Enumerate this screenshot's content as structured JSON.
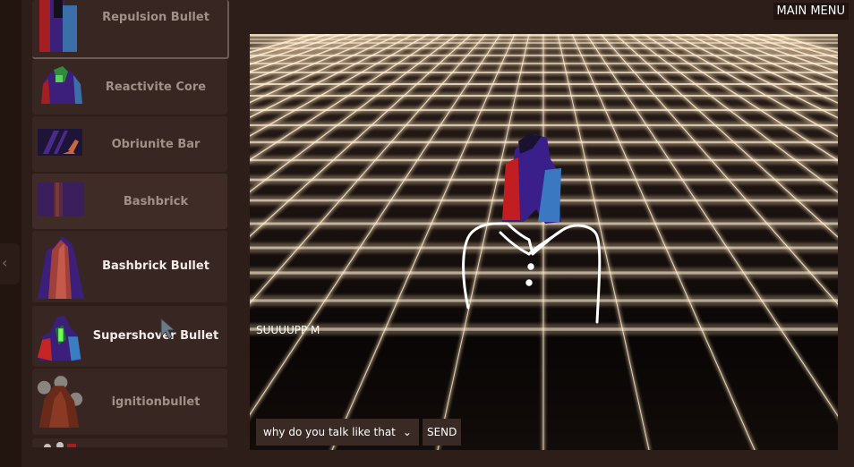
{
  "header": {
    "main_menu_label": "MAIN MENU"
  },
  "sidebar": {
    "items": [
      {
        "label": "Repulsion Bullet",
        "icon": "repulsion-bullet-icon"
      },
      {
        "label": "Reactivite Core",
        "icon": "reactivite-core-icon"
      },
      {
        "label": "Obriunite Bar",
        "icon": "obriunite-bar-icon"
      },
      {
        "label": "Bashbrick",
        "icon": "bashbrick-icon"
      },
      {
        "label": "Bashbrick Bullet",
        "icon": "bashbrick-bullet-icon"
      },
      {
        "label": "Supershover Bullet",
        "icon": "supershover-bullet-icon"
      },
      {
        "label": "ignitionbullet",
        "icon": "ignitionbullet-icon"
      }
    ]
  },
  "viewport": {
    "speech_text": "SUUUUPP M",
    "chat_option": "why do you talk like that",
    "send_label": "SEND"
  }
}
